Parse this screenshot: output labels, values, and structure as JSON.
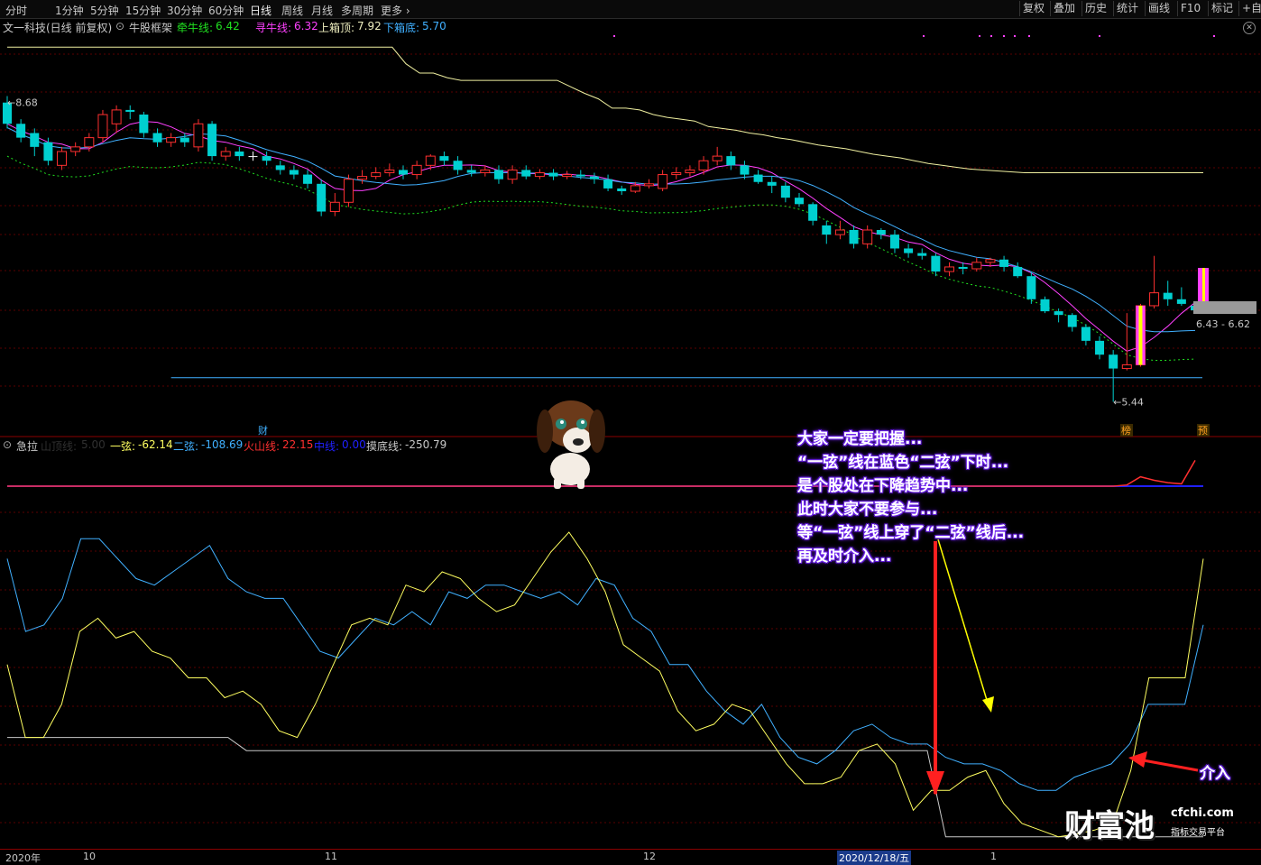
{
  "toolbar": {
    "periods": [
      "分时",
      "1分钟",
      "5分钟",
      "15分钟",
      "30分钟",
      "60分钟",
      "日线",
      "周线",
      "月线",
      "多周期",
      "更多"
    ],
    "right_buttons": [
      "复权",
      "叠加",
      "历史",
      "统计",
      "画线",
      "F10",
      "标记",
      "+自"
    ]
  },
  "main_info": {
    "stock": "文一科技(日线 前复权)",
    "indicator": "牛股框架",
    "items": [
      {
        "label": "牵牛线:",
        "value": "6.42",
        "color": "#20e020"
      },
      {
        "label": "寻牛线:",
        "value": "6.32",
        "color": "#ff40ff"
      },
      {
        "label": "上箱顶:",
        "value": "7.92",
        "color": "#f0f0c0"
      },
      {
        "label": "下箱底:",
        "value": "5.70",
        "color": "#40b0ff"
      }
    ]
  },
  "sub_info": {
    "name": "急拉",
    "items": [
      {
        "label": "山顶线:",
        "value": "5.00",
        "color": "#303030"
      },
      {
        "label": "一弦:",
        "value": "-62.14",
        "color": "#ffff60"
      },
      {
        "label": "二弦:",
        "value": "-108.69",
        "color": "#40b0ff"
      },
      {
        "label": "火山线:",
        "value": "22.15",
        "color": "#ff3030"
      },
      {
        "label": "中线:",
        "value": "0.00",
        "color": "#2020ff"
      },
      {
        "label": "摸底线:",
        "value": "-250.79",
        "color": "#c8c8c8"
      }
    ]
  },
  "chart_data": [
    {
      "type": "candlestick",
      "title": "文一科技(日线 前复权)",
      "labels": {
        "high": "8.68",
        "low": "5.44",
        "range": "6.43 - 6.62",
        "fin_marker": "财",
        "tag1": "榜",
        "tag2": "预"
      },
      "ohlc": [
        [
          8.68,
          8.45,
          8.75,
          8.4
        ],
        [
          8.45,
          8.3,
          8.5,
          8.25
        ],
        [
          8.35,
          8.2,
          8.4,
          8.1
        ],
        [
          8.25,
          8.05,
          8.3,
          8.0
        ],
        [
          8.0,
          8.15,
          8.2,
          7.95
        ],
        [
          8.15,
          8.2,
          8.25,
          8.1
        ],
        [
          8.2,
          8.3,
          8.35,
          8.15
        ],
        [
          8.3,
          8.55,
          8.6,
          8.25
        ],
        [
          8.45,
          8.6,
          8.65,
          8.35
        ],
        [
          8.6,
          8.58,
          8.65,
          8.5
        ],
        [
          8.55,
          8.35,
          8.58,
          8.3
        ],
        [
          8.35,
          8.25,
          8.4,
          8.2
        ],
        [
          8.25,
          8.3,
          8.35,
          8.2
        ],
        [
          8.3,
          8.25,
          8.35,
          8.2
        ],
        [
          8.2,
          8.45,
          8.5,
          8.15
        ],
        [
          8.45,
          8.1,
          8.48,
          8.05
        ],
        [
          8.1,
          8.15,
          8.2,
          8.05
        ],
        [
          8.15,
          8.1,
          8.2,
          8.05
        ],
        [
          8.1,
          8.1,
          8.15,
          8.05
        ],
        [
          8.1,
          8.05,
          8.15,
          8.0
        ],
        [
          8.0,
          7.95,
          8.05,
          7.9
        ],
        [
          7.95,
          7.9,
          8.0,
          7.85
        ],
        [
          7.9,
          7.8,
          7.95,
          7.75
        ],
        [
          7.8,
          7.5,
          7.85,
          7.45
        ],
        [
          7.5,
          7.6,
          7.7,
          7.45
        ],
        [
          7.6,
          7.85,
          7.9,
          7.55
        ],
        [
          7.85,
          7.88,
          7.95,
          7.8
        ],
        [
          7.88,
          7.92,
          7.98,
          7.85
        ],
        [
          7.92,
          7.95,
          8.02,
          7.88
        ],
        [
          7.95,
          7.9,
          8.0,
          7.85
        ],
        [
          7.9,
          8.0,
          8.05,
          7.85
        ],
        [
          8.0,
          8.1,
          8.12,
          7.95
        ],
        [
          8.1,
          8.05,
          8.15,
          8.0
        ],
        [
          8.05,
          7.95,
          8.1,
          7.9
        ],
        [
          7.95,
          7.92,
          8.0,
          7.88
        ],
        [
          7.92,
          7.95,
          8.0,
          7.88
        ],
        [
          7.95,
          7.85,
          8.0,
          7.8
        ],
        [
          7.85,
          7.95,
          8.0,
          7.8
        ],
        [
          7.95,
          7.88,
          8.0,
          7.85
        ],
        [
          7.88,
          7.92,
          7.96,
          7.85
        ],
        [
          7.92,
          7.88,
          7.96,
          7.84
        ],
        [
          7.88,
          7.9,
          7.94,
          7.85
        ],
        [
          7.9,
          7.88,
          7.95,
          7.85
        ],
        [
          7.88,
          7.85,
          7.92,
          7.8
        ],
        [
          7.85,
          7.75,
          7.9,
          7.72
        ],
        [
          7.75,
          7.72,
          7.78,
          7.68
        ],
        [
          7.72,
          7.78,
          7.82,
          7.7
        ],
        [
          7.78,
          7.8,
          7.85,
          7.75
        ],
        [
          7.75,
          7.9,
          7.95,
          7.72
        ],
        [
          7.9,
          7.92,
          7.98,
          7.85
        ],
        [
          7.92,
          7.95,
          8.0,
          7.88
        ],
        [
          7.95,
          8.05,
          8.1,
          7.9
        ],
        [
          8.05,
          8.1,
          8.2,
          8.0
        ],
        [
          8.1,
          8.0,
          8.15,
          7.95
        ],
        [
          8.0,
          7.9,
          8.05,
          7.85
        ],
        [
          7.9,
          7.82,
          7.95,
          7.8
        ],
        [
          7.82,
          7.78,
          7.88,
          7.7
        ],
        [
          7.78,
          7.65,
          7.82,
          7.6
        ],
        [
          7.65,
          7.58,
          7.7,
          7.55
        ],
        [
          7.58,
          7.4,
          7.6,
          7.35
        ],
        [
          7.35,
          7.25,
          7.4,
          7.15
        ],
        [
          7.25,
          7.3,
          7.4,
          7.2
        ],
        [
          7.3,
          7.15,
          7.35,
          7.1
        ],
        [
          7.15,
          7.3,
          7.35,
          7.1
        ],
        [
          7.3,
          7.25,
          7.32,
          7.2
        ],
        [
          7.25,
          7.1,
          7.3,
          7.05
        ],
        [
          7.1,
          7.05,
          7.15,
          7.0
        ],
        [
          7.05,
          7.02,
          7.1,
          6.98
        ],
        [
          7.02,
          6.85,
          7.05,
          6.8
        ],
        [
          6.85,
          6.9,
          6.95,
          6.8
        ],
        [
          6.9,
          6.88,
          6.95,
          6.82
        ],
        [
          6.88,
          6.95,
          7.0,
          6.85
        ],
        [
          6.95,
          6.98,
          7.0,
          6.9
        ],
        [
          6.98,
          6.9,
          7.02,
          6.85
        ],
        [
          6.9,
          6.8,
          6.95,
          6.78
        ],
        [
          6.8,
          6.55,
          6.85,
          6.5
        ],
        [
          6.55,
          6.42,
          6.58,
          6.4
        ],
        [
          6.42,
          6.38,
          6.45,
          6.3
        ],
        [
          6.38,
          6.25,
          6.4,
          6.2
        ],
        [
          6.25,
          6.1,
          6.28,
          6.05
        ],
        [
          6.1,
          5.95,
          6.15,
          5.9
        ],
        [
          5.95,
          5.8,
          6.0,
          5.44
        ],
        [
          5.8,
          5.84,
          6.4,
          5.78
        ],
        [
          5.84,
          6.48,
          6.5,
          5.82
        ],
        [
          6.48,
          6.62,
          7.02,
          6.45
        ],
        [
          6.62,
          6.55,
          6.75,
          6.48
        ],
        [
          6.55,
          6.5,
          6.68,
          6.48
        ],
        [
          6.48,
          6.43,
          6.52,
          6.4
        ]
      ],
      "ylim": [
        5.2,
        9.4
      ],
      "overlays": {
        "upper_box_top": [
          9.28,
          9.28,
          9.28,
          9.28,
          9.28,
          9.28,
          9.28,
          9.28,
          9.28,
          9.28,
          9.28,
          9.28,
          9.28,
          9.28,
          9.28,
          9.28,
          9.28,
          9.28,
          9.28,
          9.28,
          9.28,
          9.28,
          9.28,
          9.28,
          9.28,
          9.28,
          9.28,
          9.28,
          9.28,
          9.1,
          9.0,
          9.0,
          8.95,
          8.92,
          8.92,
          8.92,
          8.92,
          8.92,
          8.92,
          8.92,
          8.92,
          8.85,
          8.78,
          8.72,
          8.62,
          8.62,
          8.6,
          8.55,
          8.52,
          8.5,
          8.48,
          8.42,
          8.4,
          8.38,
          8.35,
          8.33,
          8.3,
          8.28,
          8.25,
          8.22,
          8.2,
          8.18,
          8.15,
          8.12,
          8.1,
          8.08,
          8.05,
          8.02,
          8.0,
          7.98,
          7.96,
          7.95,
          7.94,
          7.93,
          7.92,
          7.92,
          7.92,
          7.92,
          7.92,
          7.92,
          7.92,
          7.92,
          7.92,
          7.92,
          7.92,
          7.92,
          7.92,
          7.92
        ],
        "lower_box_bottom": 5.7
      },
      "xaxis_labels": [
        "2020年",
        "10",
        "11",
        "12",
        "2020/12/18/五",
        "1"
      ]
    },
    {
      "type": "line",
      "title": "急拉",
      "series": [
        {
          "name": "一弦",
          "color": "#ffff60"
        },
        {
          "name": "二弦",
          "color": "#40b0ff"
        },
        {
          "name": "火山线",
          "color": "#ff3030"
        },
        {
          "name": "中线",
          "color": "#2020ff"
        },
        {
          "name": "摸底线",
          "color": "#c8c8c8"
        }
      ],
      "yi_xian": [
        -120,
        -175,
        -175,
        -150,
        -95,
        -85,
        -100,
        -95,
        -110,
        -115,
        -130,
        -130,
        -145,
        -140,
        -150,
        -170,
        -175,
        -150,
        -120,
        -90,
        -85,
        -90,
        -60,
        -65,
        -50,
        -55,
        -70,
        -80,
        -75,
        -55,
        -35,
        -20,
        -40,
        -65,
        -105,
        -115,
        -125,
        -155,
        -170,
        -165,
        -150,
        -155,
        -175,
        -195,
        -210,
        -210,
        -205,
        -185,
        -180,
        -195,
        -230,
        -215,
        -215,
        -205,
        -200,
        -225,
        -240,
        -245,
        -250,
        -248,
        -245,
        -240,
        -200,
        -130,
        -130,
        -130,
        -40
      ],
      "er_xian": [
        -40,
        -95,
        -90,
        -70,
        -25,
        -25,
        -40,
        -55,
        -60,
        -50,
        -40,
        -30,
        -55,
        -65,
        -70,
        -70,
        -90,
        -110,
        -115,
        -100,
        -85,
        -90,
        -80,
        -90,
        -65,
        -70,
        -60,
        -60,
        -65,
        -70,
        -65,
        -75,
        -55,
        -60,
        -85,
        -95,
        -120,
        -120,
        -140,
        -155,
        -165,
        -150,
        -175,
        -190,
        -195,
        -185,
        -170,
        -165,
        -175,
        -180,
        -180,
        -190,
        -195,
        -195,
        -200,
        -210,
        -215,
        -215,
        -205,
        -200,
        -195,
        -180,
        -150,
        -150,
        -150,
        -90
      ],
      "mo_di_xian": [
        -175,
        -175,
        -175,
        -175,
        -175,
        -175,
        -175,
        -175,
        -175,
        -175,
        -175,
        -175,
        -175,
        -185,
        -185,
        -185,
        -185,
        -185,
        -185,
        -185,
        -185,
        -185,
        -185,
        -185,
        -185,
        -185,
        -185,
        -185,
        -185,
        -185,
        -185,
        -185,
        -185,
        -185,
        -185,
        -185,
        -185,
        -185,
        -185,
        -185,
        -185,
        -185,
        -185,
        -185,
        -185,
        -185,
        -185,
        -185,
        -185,
        -185,
        -185,
        -250,
        -250,
        -250,
        -250,
        -250,
        -250,
        -250,
        -250,
        -250,
        -250,
        -250,
        -250,
        -250,
        -250,
        -250
      ],
      "huo_shan": [
        0,
        0,
        0,
        0,
        0,
        0,
        0,
        0,
        0,
        0,
        0,
        0,
        0,
        0,
        0,
        0,
        0,
        0,
        0,
        0,
        0,
        0,
        0,
        0,
        0,
        0,
        0,
        0,
        0,
        0,
        0,
        0,
        0,
        0,
        0,
        0,
        0,
        0,
        0,
        0,
        0,
        0,
        0,
        0,
        0,
        0,
        0,
        0,
        0,
        0,
        0,
        0,
        0,
        0,
        0,
        0,
        0,
        0,
        0,
        0,
        0,
        0,
        0,
        0,
        0,
        0,
        0,
        0,
        0,
        0,
        0,
        0,
        0,
        0,
        0,
        0,
        0,
        0,
        0,
        0,
        0,
        0,
        1,
        8,
        5,
        3,
        2,
        22
      ]
    }
  ],
  "annotation": {
    "lines": [
      "大家一定要把握...",
      "“一弦”线在蓝色“二弦”下时...",
      "是个股处在下降趋势中...",
      "此时大家不要参与...",
      "等“一弦”线上穿了“二弦”线后...",
      "再及时介入..."
    ],
    "entry_label": "介入"
  },
  "logo": {
    "cn": "财富池",
    "en": "cfchi.com",
    "sub": "指标交易平台"
  }
}
